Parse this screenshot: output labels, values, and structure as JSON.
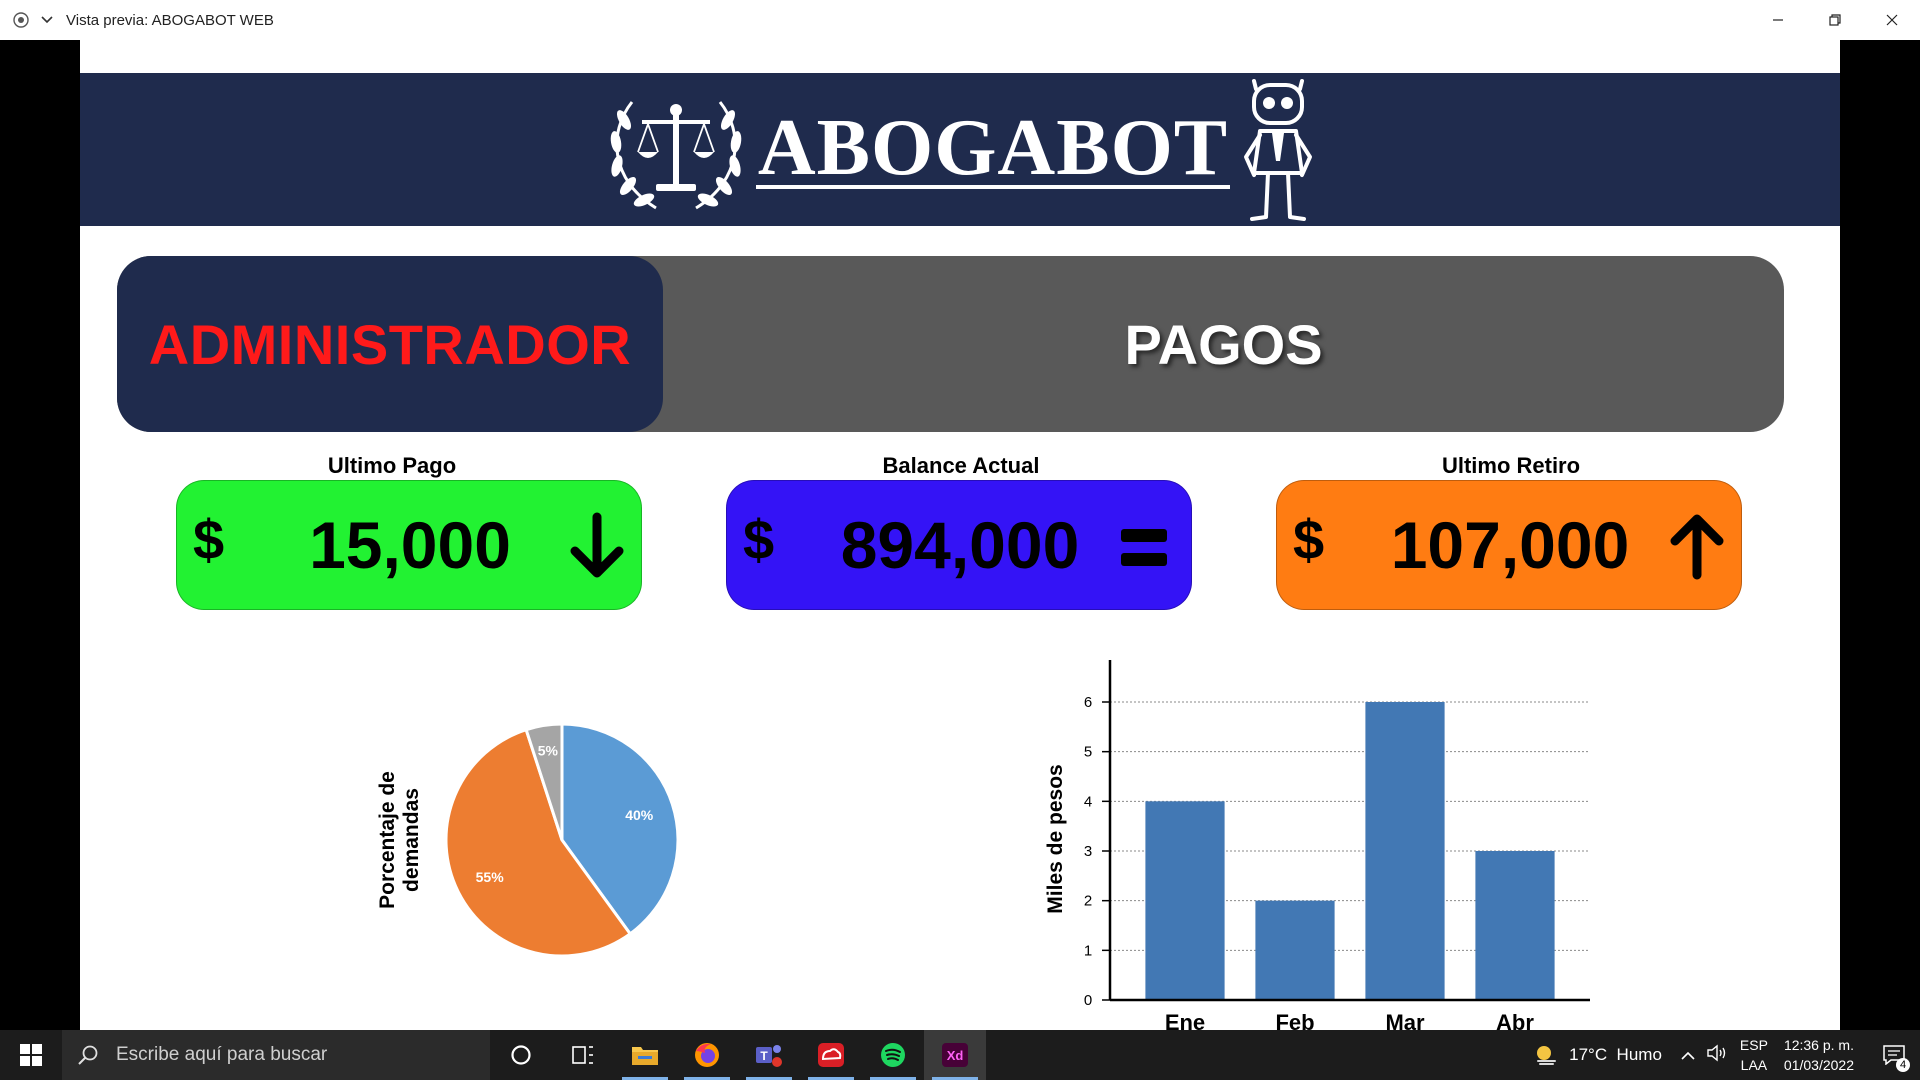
{
  "window": {
    "title": "Vista previa: ABOGABOT WEB"
  },
  "banner": {
    "brand": "ABOGABOT"
  },
  "section": {
    "role": "ADMINISTRADOR",
    "title": "PAGOS"
  },
  "cards": [
    {
      "label": "Ultimo Pago",
      "currency": "$",
      "amount": "15,000",
      "indicator": "arrow-down-icon",
      "color": "#22f232"
    },
    {
      "label": "Balance Actual",
      "currency": "$",
      "amount": "894,000",
      "indicator": "equals-icon",
      "color": "#3413f6"
    },
    {
      "label": "Ultimo Retiro",
      "currency": "$",
      "amount": "107,000",
      "indicator": "arrow-up-icon",
      "color": "#ff7c12"
    }
  ],
  "chart_data": [
    {
      "type": "pie",
      "ylabel": "Porcentaje de demandas",
      "slices": [
        {
          "label": "40%",
          "value": 40,
          "color": "#5b9bd5"
        },
        {
          "label": "55%",
          "value": 55,
          "color": "#ed7d31"
        },
        {
          "label": "5%",
          "value": 5,
          "color": "#a5a5a5"
        }
      ]
    },
    {
      "type": "bar",
      "categories": [
        "Ene",
        "Feb",
        "Mar",
        "Abr"
      ],
      "values": [
        4,
        2,
        6,
        3
      ],
      "ylabel": "Miles de pesos",
      "yticks": [
        "0",
        "1",
        "2",
        "3",
        "4",
        "5",
        "6"
      ],
      "ylim": [
        0,
        6
      ],
      "grid": true,
      "bar_color": "#4278b4"
    }
  ],
  "taskbar": {
    "search_placeholder": "Escribe aquí para buscar",
    "apps": [
      "cortana-icon",
      "task-view-icon",
      "file-explorer-icon",
      "firefox-icon",
      "teams-icon",
      "creative-cloud-icon",
      "spotify-icon",
      "adobe-xd-icon"
    ],
    "xd_label": "Xd",
    "weather": "17°C  Humo",
    "lang_top": "ESP",
    "lang_bottom": "LAA",
    "time": "12:36 p. m.",
    "date": "01/03/2022",
    "notifications": "4"
  }
}
